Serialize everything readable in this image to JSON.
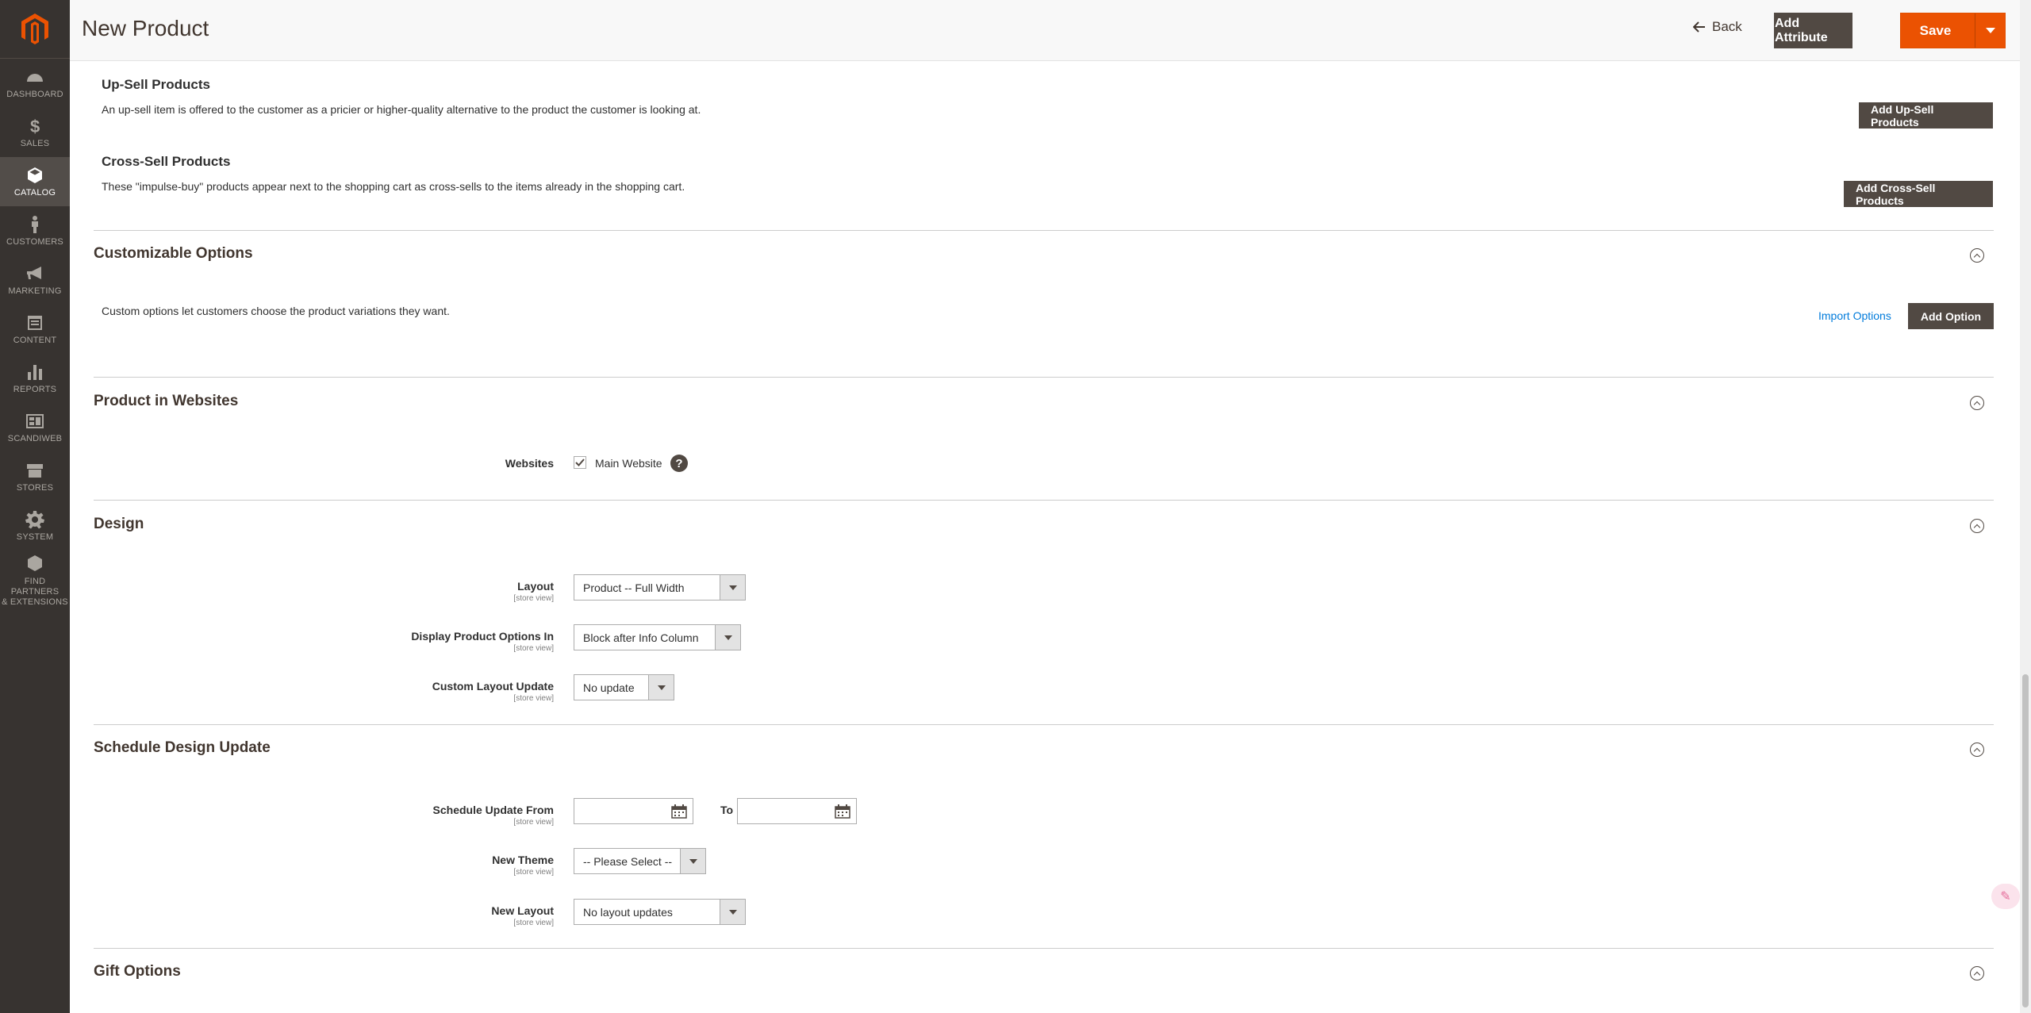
{
  "sidebar": {
    "items": [
      {
        "label": "DASHBOARD",
        "icon": "dashboard-icon"
      },
      {
        "label": "SALES",
        "icon": "dollar-icon"
      },
      {
        "label": "CATALOG",
        "icon": "cube-icon",
        "active": true
      },
      {
        "label": "CUSTOMERS",
        "icon": "person-icon"
      },
      {
        "label": "MARKETING",
        "icon": "megaphone-icon"
      },
      {
        "label": "CONTENT",
        "icon": "content-icon"
      },
      {
        "label": "REPORTS",
        "icon": "bar-chart-icon"
      },
      {
        "label": "SCANDIWEB",
        "icon": "layout-icon"
      },
      {
        "label": "STORES",
        "icon": "store-icon"
      },
      {
        "label": "SYSTEM",
        "icon": "gear-icon"
      },
      {
        "label1": "FIND PARTNERS",
        "label2": "& EXTENSIONS",
        "icon": "cubes-icon"
      }
    ]
  },
  "header": {
    "title": "New Product",
    "back_label": "Back",
    "add_attribute_label": "Add Attribute",
    "save_label": "Save"
  },
  "related": {
    "upsell": {
      "title": "Up-Sell Products",
      "description": "An up-sell item is offered to the customer as a pricier or higher-quality alternative to the product the customer is looking at.",
      "button": "Add Up-Sell Products"
    },
    "crosssell": {
      "title": "Cross-Sell Products",
      "description": "These \"impulse-buy\" products appear next to the shopping cart as cross-sells to the items already in the shopping cart.",
      "button": "Add Cross-Sell Products"
    }
  },
  "customizable_options": {
    "title": "Customizable Options",
    "description": "Custom options let customers choose the product variations they want.",
    "import_link": "Import Options",
    "add_button": "Add Option"
  },
  "websites": {
    "title": "Product in Websites",
    "label": "Websites",
    "checkbox_label": "Main Website",
    "checked": true
  },
  "design": {
    "title": "Design",
    "scope": "[store view]",
    "layout_label": "Layout",
    "layout_value": "Product -- Full Width",
    "display_label": "Display Product Options In",
    "display_value": "Block after Info Column",
    "custom_label": "Custom Layout Update",
    "custom_value": "No update"
  },
  "schedule": {
    "title": "Schedule Design Update",
    "from_label": "Schedule Update From",
    "to_label": "To",
    "from_value": "",
    "to_value": "",
    "theme_label": "New Theme",
    "theme_value": "-- Please Select --",
    "layout_label": "New Layout",
    "layout_value": "No layout updates"
  },
  "gift": {
    "title": "Gift Options"
  },
  "colors": {
    "sidebar_bg": "#373330",
    "accent_orange": "#eb5202",
    "button_dark": "#514943",
    "link_blue": "#007bdb"
  }
}
